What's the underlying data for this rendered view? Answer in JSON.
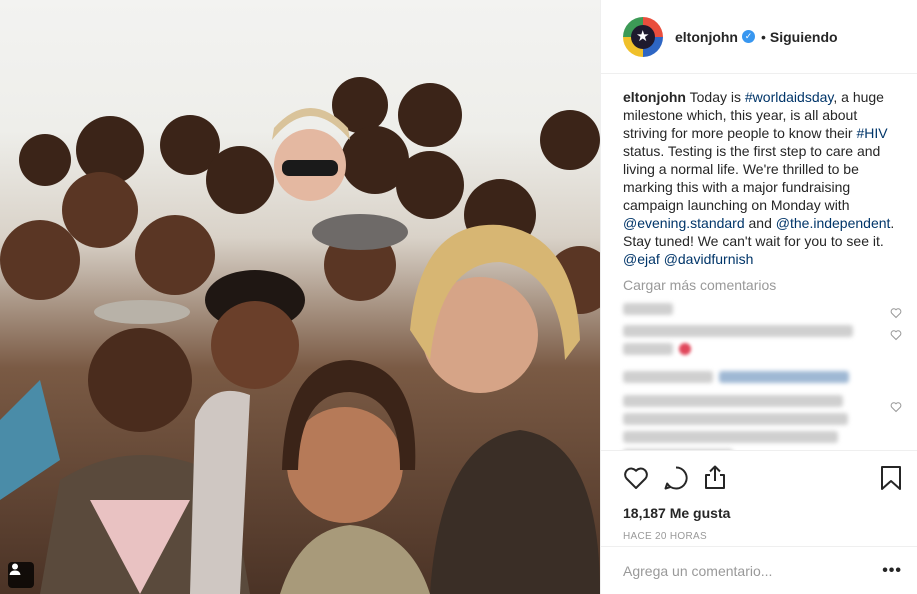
{
  "post": {
    "photo_alt": "",
    "user_tag_icon": "person-icon"
  },
  "header": {
    "username": "eltonjohn",
    "separator": "•",
    "follow_state": "Siguiendo"
  },
  "caption": {
    "username": "eltonjohn",
    "text_1": " Today is ",
    "tag_1": "#worldaidsday",
    "text_2": ", a huge milestone which, this year, is all about striving for more people to know their ",
    "tag_2": "#HIV",
    "text_3": " status. Testing is the first step to care and living a normal life. We're thrilled to be marking this with a major fundraising campaign launching on Monday with ",
    "mention_1": "@evening.standard",
    "text_4": " and ",
    "mention_2": "@the.independent",
    "text_5": ". Stay tuned! We can't wait for you to see it. ",
    "mention_3": "@ejaf",
    "text_6": " ",
    "mention_4": "@davidfurnish"
  },
  "comments": {
    "load_more": "Cargar más comentarios"
  },
  "actions": {
    "likes": "18,187 Me gusta",
    "time": "HACE 20 HORAS",
    "icons": [
      "heart-icon",
      "comment-icon",
      "share-icon",
      "bookmark-icon"
    ]
  },
  "add_comment": {
    "placeholder": "Agrega un comentario...",
    "more": "•••"
  },
  "colors": {
    "link": "#003569",
    "verified": "#3897f0",
    "muted": "#999999",
    "text": "#262626"
  }
}
